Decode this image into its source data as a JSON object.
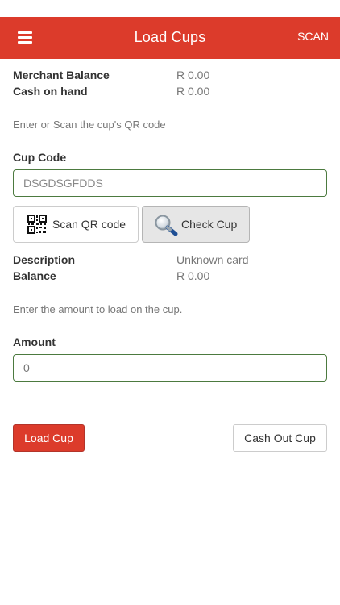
{
  "header": {
    "title": "Load Cups",
    "scan_label": "SCAN",
    "bar_color": "#dc3b2b"
  },
  "balances": {
    "merchant_label": "Merchant Balance",
    "merchant_value": "R 0.00",
    "cash_label": "Cash on hand",
    "cash_value": "R 0.00"
  },
  "cup": {
    "hint": "Enter or Scan the cup's QR code",
    "label": "Cup Code",
    "value": "DSGDSGFDDS",
    "scan_qr_label": "Scan QR code",
    "check_cup_label": "Check Cup"
  },
  "card": {
    "description_label": "Description",
    "description_value": "Unknown card",
    "balance_label": "Balance",
    "balance_value": "R 0.00"
  },
  "amount": {
    "hint": "Enter the amount to load on the cup.",
    "label": "Amount",
    "placeholder": "0"
  },
  "actions": {
    "load_label": "Load Cup",
    "cash_out_label": "Cash Out Cup"
  },
  "icons": {
    "menu": "hamburger-menu-icon",
    "qr": "qr-code-icon",
    "check": "magnifier-icon"
  }
}
